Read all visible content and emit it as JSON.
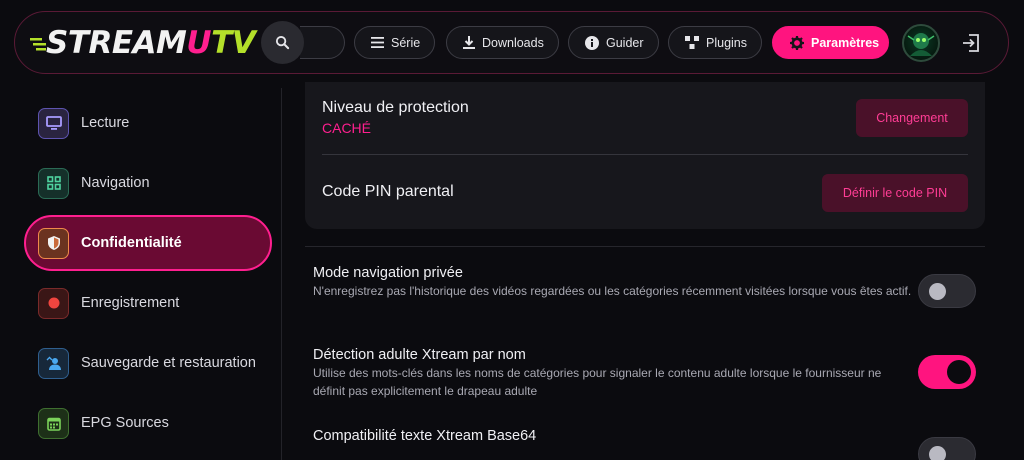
{
  "app": {
    "logo_parts": [
      "S",
      "TREAM",
      "U",
      "TV"
    ]
  },
  "nav": {
    "items": [
      {
        "label": "Série",
        "icon": "list-icon"
      },
      {
        "label": "Downloads",
        "icon": "download-icon"
      },
      {
        "label": "Guider",
        "icon": "info-icon"
      },
      {
        "label": "Plugins",
        "icon": "plugins-icon"
      },
      {
        "label": "Paramètres",
        "icon": "gear-icon",
        "active": true
      }
    ]
  },
  "sidebar": {
    "items": [
      {
        "label": "Lecture",
        "icon": "tv-icon",
        "color": "#8a7cf0"
      },
      {
        "label": "Navigation",
        "icon": "grid-icon",
        "color": "#3fb889"
      },
      {
        "label": "Confidentialité",
        "icon": "shield-icon",
        "color": "#f08a4a",
        "active": true
      },
      {
        "label": "Enregistrement",
        "icon": "record-icon",
        "color": "#f0453f"
      },
      {
        "label": "Sauvegarde et restauration",
        "icon": "backup-icon",
        "color": "#4aa8f0"
      },
      {
        "label": "EPG Sources",
        "icon": "calendar-icon",
        "color": "#7bd35a"
      }
    ]
  },
  "protection": {
    "title": "Niveau de protection",
    "value": "CACHÉ",
    "button": "Changement"
  },
  "pin": {
    "title": "Code PIN parental",
    "button": "Définir le code PIN"
  },
  "settings": [
    {
      "title": "Mode navigation privée",
      "description": "N'enregistrez pas l'historique des vidéos regardées ou les catégories récemment visitées lorsque vous êtes actif.",
      "enabled": false
    },
    {
      "title": "Détection adulte Xtream par nom",
      "description": "Utilise des mots-clés dans les noms de catégories pour signaler le contenu adulte lorsque le fournisseur ne définit pas explicitement le drapeau adulte",
      "enabled": true
    },
    {
      "title": "Compatibilité texte Xtream Base64",
      "description": "",
      "enabled": false
    }
  ],
  "colors": {
    "accent": "#ff147f",
    "background": "#0b0b0f"
  }
}
